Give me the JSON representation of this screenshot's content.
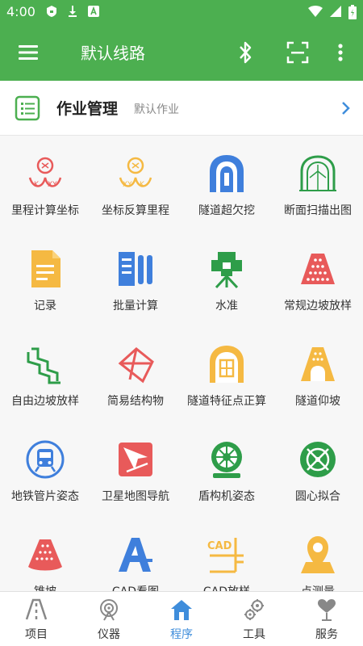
{
  "status_bar": {
    "time": "4:00"
  },
  "app_bar": {
    "title": "默认线路"
  },
  "job": {
    "title": "作业管理",
    "subtitle": "默认作业"
  },
  "grid": {
    "items": [
      {
        "label": "里程计算坐标",
        "icon": "mileage-to-coord-icon"
      },
      {
        "label": "坐标反算里程",
        "icon": "coord-to-mileage-icon"
      },
      {
        "label": "隧道超欠挖",
        "icon": "tunnel-overbreak-icon"
      },
      {
        "label": "断面扫描出图",
        "icon": "section-scan-icon"
      },
      {
        "label": "记录",
        "icon": "record-icon"
      },
      {
        "label": "批量计算",
        "icon": "batch-calc-icon"
      },
      {
        "label": "水准",
        "icon": "level-icon"
      },
      {
        "label": "常规边坡放样",
        "icon": "slope-stakeout-icon"
      },
      {
        "label": "自由边坡放样",
        "icon": "free-slope-icon"
      },
      {
        "label": "简易结构物",
        "icon": "simple-structure-icon"
      },
      {
        "label": "隧道特征点正算",
        "icon": "tunnel-feature-icon"
      },
      {
        "label": "隧道仰坡",
        "icon": "tunnel-slope-icon"
      },
      {
        "label": "地铁管片姿态",
        "icon": "metro-segment-icon"
      },
      {
        "label": "卫星地图导航",
        "icon": "satellite-map-icon"
      },
      {
        "label": "盾构机姿态",
        "icon": "shield-machine-icon"
      },
      {
        "label": "圆心拟合",
        "icon": "circle-fit-icon"
      },
      {
        "label": "锥坡",
        "icon": "cone-slope-icon"
      },
      {
        "label": "CAD看图",
        "icon": "cad-view-icon"
      },
      {
        "label": "CAD放样",
        "icon": "cad-stakeout-icon"
      },
      {
        "label": "点测量",
        "icon": "point-measure-icon"
      }
    ]
  },
  "bottom_nav": {
    "items": [
      {
        "label": "项目",
        "icon": "project-icon"
      },
      {
        "label": "仪器",
        "icon": "instrument-icon"
      },
      {
        "label": "程序",
        "icon": "home-icon"
      },
      {
        "label": "工具",
        "icon": "tools-icon"
      },
      {
        "label": "服务",
        "icon": "service-icon"
      }
    ],
    "active": "程序"
  },
  "colors": {
    "primary": "#4caf50",
    "accent_blue": "#3f8ddb",
    "red": "#e85a5a",
    "orange": "#f5b942",
    "green": "#2e9d49",
    "blue": "#3f7fdc"
  }
}
